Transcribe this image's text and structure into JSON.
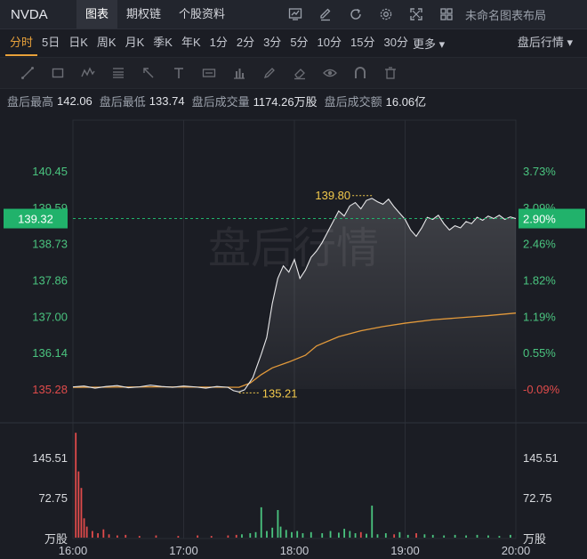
{
  "header": {
    "ticker": "NVDA",
    "tabs": [
      "图表",
      "期权链",
      "个股资料"
    ],
    "active_tab": 0,
    "layout_name": "未命名图表布局",
    "tool_icons": [
      "chart-icon",
      "edit-icon",
      "refresh-icon",
      "gear-icon",
      "fullscreen-icon",
      "grid-icon"
    ]
  },
  "periods": {
    "items": [
      "分时",
      "5日",
      "日K",
      "周K",
      "月K",
      "季K",
      "年K",
      "1分",
      "2分",
      "3分",
      "5分",
      "10分",
      "15分",
      "30分"
    ],
    "active": 0,
    "more_label": "更多",
    "session_label": "盘后行情"
  },
  "draw_tools": [
    "line-tool-icon",
    "rect-tool-icon",
    "wave-tool-icon",
    "fib-tool-icon",
    "arrow-tool-icon",
    "text-tool-icon",
    "price-tool-icon",
    "measure-tool-icon",
    "pen-tool-icon",
    "eraser-tool-icon",
    "eye-icon",
    "magnet-icon",
    "delete-icon"
  ],
  "info": {
    "high_label": "盘后最高",
    "high": "142.06",
    "low_label": "盘后最低",
    "low": "133.74",
    "vol_label": "盘后成交量",
    "vol": "1174.26万股",
    "amt_label": "盘后成交额",
    "amt": "16.06亿"
  },
  "watermark": "盘后行情",
  "colors": {
    "up": "#4ac47f",
    "down": "#e04b4b",
    "price_line": "#e8e8ea",
    "avg_line": "#e39a3b",
    "current_tag": "#21b26b",
    "marker": "#f2c94c"
  },
  "chart_data": {
    "type": "line",
    "ylim": [
      135.28,
      140.45
    ],
    "y_ticks_left": [
      "140.45",
      "139.59",
      "138.73",
      "137.86",
      "137.00",
      "136.14",
      "135.28"
    ],
    "y_ticks_right": [
      "3.73%",
      "3.09%",
      "2.46%",
      "1.82%",
      "1.19%",
      "0.55%",
      "-0.09%"
    ],
    "x_ticks": [
      "16:00",
      "17:00",
      "18:00",
      "19:00",
      "20:00"
    ],
    "current_price": "139.32",
    "current_pct": "2.90%",
    "max_marker": "139.80",
    "min_marker": "135.21",
    "price_series": [
      [
        0,
        135.33
      ],
      [
        4,
        135.35
      ],
      [
        8,
        135.3
      ],
      [
        12,
        135.34
      ],
      [
        16,
        135.36
      ],
      [
        20,
        135.31
      ],
      [
        24,
        135.33
      ],
      [
        28,
        135.37
      ],
      [
        32,
        135.34
      ],
      [
        36,
        135.32
      ],
      [
        40,
        135.35
      ],
      [
        44,
        135.33
      ],
      [
        48,
        135.3
      ],
      [
        52,
        135.34
      ],
      [
        56,
        135.32
      ],
      [
        58,
        135.24
      ],
      [
        60,
        135.21
      ],
      [
        62,
        135.26
      ],
      [
        65,
        135.55
      ],
      [
        68,
        136.1
      ],
      [
        70,
        136.5
      ],
      [
        72,
        137.3
      ],
      [
        74,
        137.9
      ],
      [
        76,
        138.2
      ],
      [
        78,
        138.05
      ],
      [
        80,
        138.35
      ],
      [
        82,
        137.9
      ],
      [
        84,
        138.1
      ],
      [
        86,
        138.4
      ],
      [
        88,
        138.55
      ],
      [
        90,
        138.75
      ],
      [
        92,
        139.0
      ],
      [
        94,
        139.25
      ],
      [
        96,
        139.5
      ],
      [
        98,
        139.38
      ],
      [
        100,
        139.62
      ],
      [
        102,
        139.7
      ],
      [
        104,
        139.55
      ],
      [
        106,
        139.75
      ],
      [
        108,
        139.8
      ],
      [
        110,
        139.72
      ],
      [
        112,
        139.66
      ],
      [
        114,
        139.78
      ],
      [
        116,
        139.6
      ],
      [
        118,
        139.45
      ],
      [
        120,
        139.3
      ],
      [
        122,
        139.05
      ],
      [
        124,
        138.9
      ],
      [
        126,
        139.1
      ],
      [
        128,
        139.35
      ],
      [
        130,
        139.3
      ],
      [
        132,
        139.4
      ],
      [
        134,
        139.2
      ],
      [
        136,
        139.05
      ],
      [
        138,
        139.15
      ],
      [
        140,
        139.1
      ],
      [
        142,
        139.25
      ],
      [
        144,
        139.2
      ],
      [
        146,
        139.35
      ],
      [
        148,
        139.28
      ],
      [
        150,
        139.38
      ],
      [
        152,
        139.32
      ],
      [
        154,
        139.4
      ],
      [
        156,
        139.3
      ],
      [
        158,
        139.36
      ],
      [
        160,
        139.32
      ]
    ],
    "avg_series": [
      [
        0,
        135.32
      ],
      [
        30,
        135.33
      ],
      [
        60,
        135.32
      ],
      [
        64,
        135.42
      ],
      [
        68,
        135.62
      ],
      [
        72,
        135.78
      ],
      [
        78,
        135.92
      ],
      [
        84,
        136.08
      ],
      [
        88,
        136.3
      ],
      [
        96,
        136.52
      ],
      [
        104,
        136.66
      ],
      [
        112,
        136.76
      ],
      [
        120,
        136.84
      ],
      [
        130,
        136.92
      ],
      [
        140,
        136.97
      ],
      [
        150,
        137.02
      ],
      [
        160,
        137.08
      ]
    ],
    "volume": {
      "y_ticks": [
        "145.51",
        "72.75"
      ],
      "unit": "万股",
      "ylim": [
        0,
        200
      ],
      "bars": [
        [
          1,
          190,
          "down"
        ],
        [
          2,
          120,
          "down"
        ],
        [
          3,
          90,
          "down"
        ],
        [
          4,
          35,
          "down"
        ],
        [
          5,
          20,
          "down"
        ],
        [
          7,
          12,
          "down"
        ],
        [
          9,
          8,
          "down"
        ],
        [
          11,
          15,
          "down"
        ],
        [
          13,
          6,
          "down"
        ],
        [
          16,
          4,
          "down"
        ],
        [
          19,
          5,
          "down"
        ],
        [
          24,
          3,
          "down"
        ],
        [
          30,
          4,
          "down"
        ],
        [
          38,
          3,
          "down"
        ],
        [
          45,
          4,
          "down"
        ],
        [
          50,
          3,
          "down"
        ],
        [
          56,
          4,
          "down"
        ],
        [
          59,
          5,
          "down"
        ],
        [
          61,
          6,
          "up"
        ],
        [
          64,
          8,
          "up"
        ],
        [
          66,
          10,
          "up"
        ],
        [
          68,
          55,
          "up"
        ],
        [
          70,
          12,
          "up"
        ],
        [
          72,
          18,
          "up"
        ],
        [
          74,
          50,
          "up"
        ],
        [
          75,
          20,
          "up"
        ],
        [
          77,
          14,
          "up"
        ],
        [
          79,
          10,
          "up"
        ],
        [
          81,
          12,
          "up"
        ],
        [
          83,
          8,
          "up"
        ],
        [
          86,
          10,
          "up"
        ],
        [
          90,
          8,
          "up"
        ],
        [
          93,
          12,
          "up"
        ],
        [
          96,
          9,
          "up"
        ],
        [
          98,
          16,
          "up"
        ],
        [
          100,
          12,
          "up"
        ],
        [
          102,
          8,
          "up"
        ],
        [
          104,
          10,
          "down"
        ],
        [
          106,
          7,
          "up"
        ],
        [
          108,
          58,
          "up"
        ],
        [
          110,
          6,
          "up"
        ],
        [
          113,
          8,
          "up"
        ],
        [
          116,
          6,
          "down"
        ],
        [
          118,
          10,
          "up"
        ],
        [
          121,
          5,
          "up"
        ],
        [
          124,
          8,
          "down"
        ],
        [
          127,
          6,
          "up"
        ],
        [
          130,
          5,
          "up"
        ],
        [
          134,
          4,
          "up"
        ],
        [
          138,
          5,
          "up"
        ],
        [
          142,
          4,
          "up"
        ],
        [
          146,
          5,
          "up"
        ],
        [
          150,
          4,
          "up"
        ],
        [
          154,
          3,
          "up"
        ],
        [
          158,
          5,
          "up"
        ]
      ]
    }
  }
}
